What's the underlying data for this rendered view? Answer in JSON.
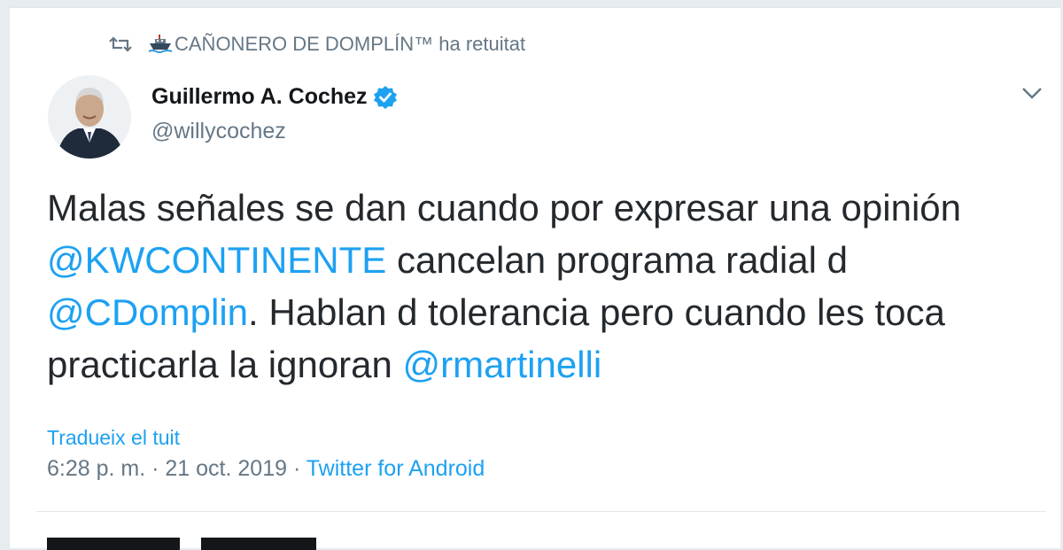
{
  "retweet": {
    "retweeter": "CAÑONERO DE DOMPLÍN™",
    "suffix": " ha retuitat"
  },
  "author": {
    "name": "Guillermo A. Cochez",
    "handle": "@willycochez",
    "verified": true
  },
  "tweet": {
    "segments": [
      {
        "text": "Malas señales se dan cuando por expresar una opinión",
        "mention": false
      },
      {
        "text": "@KWCONTINENTE",
        "mention": true
      },
      {
        "text": " cancelan programa radial d",
        "mention": false
      },
      {
        "text": "@CDomplin",
        "mention": true
      },
      {
        "text": ". Hablan d tolerancia pero cuando les toca",
        "mention": false
      },
      {
        "text": "practicarla la ignoran ",
        "mention": false
      },
      {
        "text": "@rmartinelli",
        "mention": true
      }
    ]
  },
  "translate_label": "Tradueix el tuit",
  "meta": {
    "time": "6:28 p. m.",
    "separator": " · ",
    "date": "21 oct. 2019",
    "source": "Twitter for Android"
  },
  "colors": {
    "link": "#1da1f2",
    "secondary": "#657786",
    "verified": "#1da1f2"
  },
  "icons": {
    "retweet": "retweet-icon",
    "retweeter_emoji": "ship-icon",
    "verified": "verified-badge-icon",
    "more": "chevron-down-icon"
  }
}
